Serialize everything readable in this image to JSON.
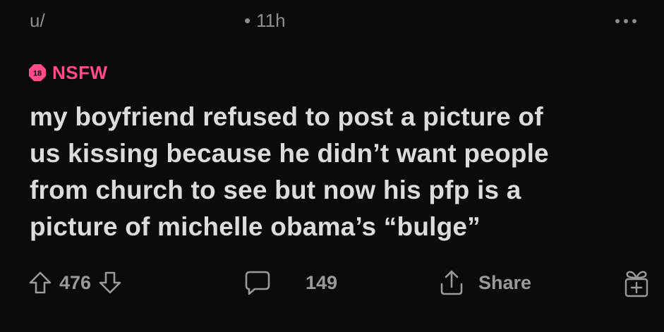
{
  "post": {
    "username": "u/",
    "time_dot": "•",
    "time_ago": "11h",
    "nsfw": {
      "badge_text": "18",
      "label": "NSFW",
      "color": "#ff4a8b"
    },
    "title": "my boyfriend refused to post a picture of us kissing because he didn’t want people from church to see but now his pfp is a picture of michelle obama’s “bulge”",
    "title_lines": [
      "my boyfriend refused to post a picture of",
      "us kissing because he didn’t want people",
      "from church to see but now his pfp is a",
      "picture of michelle obama’s “bulge”"
    ]
  },
  "actions": {
    "upvote_icon": "arrow-up-icon",
    "score": "476",
    "downvote_icon": "arrow-down-icon",
    "comment_icon": "comment-bubble-icon",
    "comment_count": "149",
    "share_icon": "share-icon",
    "share_label": "Share",
    "award_icon": "gift-award-icon"
  },
  "colors": {
    "background": "#0b0b0b",
    "text": "#dcdcdc",
    "muted": "#8e8e8e",
    "accent_nsfw": "#ff4a8b"
  }
}
